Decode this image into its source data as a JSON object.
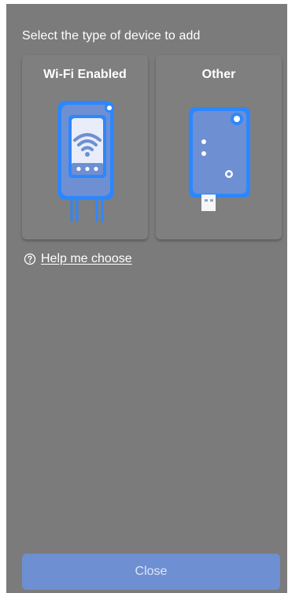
{
  "dialog": {
    "title": "Select the type of device to add"
  },
  "devices": [
    {
      "label": "Wi-Fi Enabled",
      "icon": "wifi-device-icon"
    },
    {
      "label": "Other",
      "icon": "usb-device-icon"
    }
  ],
  "help": {
    "icon": "question-circle-icon",
    "link_text": "Help me choose"
  },
  "footer": {
    "close_label": "Close"
  },
  "colors": {
    "background": "#7b7b7b",
    "card": "#7f7f7f",
    "device_blue": "#6e8fd2",
    "device_outline": "#2c87ff",
    "button_text": "#dfe6f7"
  }
}
